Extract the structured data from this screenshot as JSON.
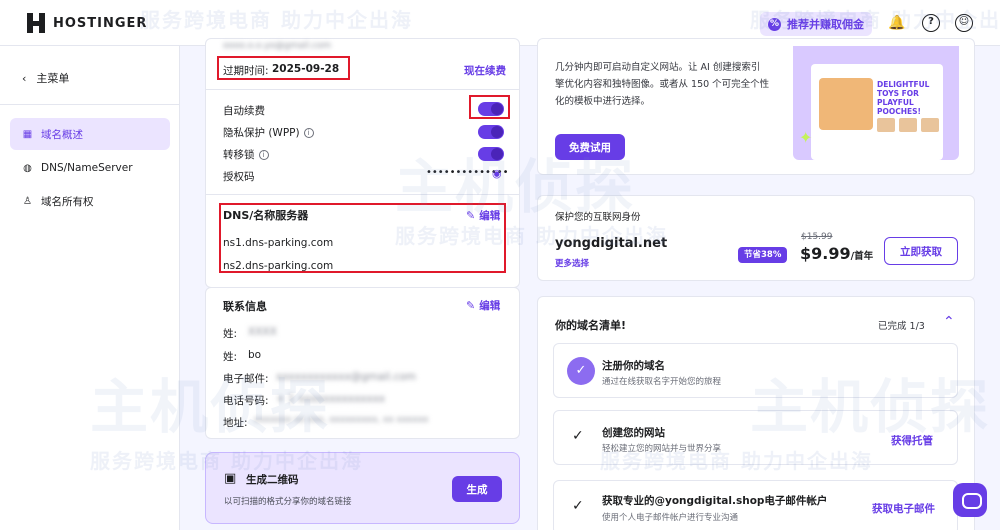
{
  "brand": {
    "name": "HOSTINGER"
  },
  "topbar": {
    "refer_label": "推荐并赚取佣金",
    "refer_icon": "percent-badge-icon",
    "bell_icon": "bell-icon",
    "help_icon": "question-icon",
    "account_icon": "user-icon"
  },
  "sidebar": {
    "back_label": "主菜单",
    "items": [
      {
        "label": "域名概述",
        "icon": "grid-icon",
        "active": true
      },
      {
        "label": "DNS/NameServer",
        "icon": "globe-icon",
        "active": false
      },
      {
        "label": "域名所有权",
        "icon": "person-icon",
        "active": false
      }
    ]
  },
  "domain_details": {
    "email_partial": "oooo.o.o.yo@gmail.com",
    "expiry_label": "过期时间:",
    "expiry_value": "2025-09-28",
    "renew_link": "现在续费",
    "auto_renew_label": "自动续费",
    "privacy_label": "隐私保护 (WPP)",
    "transfer_lock_label": "转移锁",
    "auth_code_label": "授权码",
    "auth_code_value": "••••••••••••••"
  },
  "dns": {
    "title": "DNS/名称服务器",
    "edit_label": "编辑",
    "ns1": "ns1.dns-parking.com",
    "ns2": "ns2.dns-parking.com"
  },
  "contact": {
    "title": "联系信息",
    "edit_label": "编辑",
    "last_name_label": "姓:",
    "last_name_value": "XXXX",
    "first_name_label": "姓:",
    "first_name_value": "bo",
    "email_label": "电子邮件:",
    "email_value": "xxxxxxxxxxxx@gmail.com",
    "phone_label": "电话号码:",
    "phone_value": "+ 1 xxxxxxxxxxxxxx",
    "address_label": "地址:",
    "address_value": "xxxxxxx xx xxx, xxxxxxxxx, xx xxxxxx"
  },
  "qr": {
    "title": "生成二维码",
    "subtitle": "以可扫描的格式分享你的域名链接",
    "button": "生成"
  },
  "website_promo": {
    "text_line1": "几分钟内即可启动自定义网站。让 AI 创建搜索引",
    "text_line2": "擎优化内容和独特图像。或者从 150 个可完全个性",
    "text_line3": "化的模板中进行选择。",
    "button": "免费试用",
    "image_title": "DELIGHTFUL TOYS FOR PLAYFUL POOCHES!"
  },
  "identity": {
    "heading": "保护您的互联网身份",
    "domain": "yongdigital.net",
    "more_options": "更多选择",
    "save_badge": "节省38%",
    "old_price": "$15.99",
    "price": "$9.99",
    "per_year": "/首年",
    "button": "立即获取"
  },
  "checklist": {
    "title": "你的域名清单!",
    "progress": "已完成 1/3",
    "tasks": [
      {
        "title": "注册你的域名",
        "subtitle": "通过在线获取名字开始您的旅程",
        "done": true,
        "action": ""
      },
      {
        "title": "创建您的网站",
        "subtitle": "轻松建立您的网站并与世界分享",
        "done": false,
        "action": "获得托管"
      },
      {
        "title": "获取专业的@yongdigital.shop电子邮件帐户",
        "subtitle": "使用个人电子邮件帐户进行专业沟通",
        "done": false,
        "action": "获取电子邮件"
      }
    ]
  },
  "watermarks": {
    "text1": "服务跨境电商 助力中企出海",
    "text2": "主机侦探"
  },
  "colors": {
    "accent": "#673de6",
    "highlight_box": "#e0192b",
    "background": "#f4f5ff"
  }
}
